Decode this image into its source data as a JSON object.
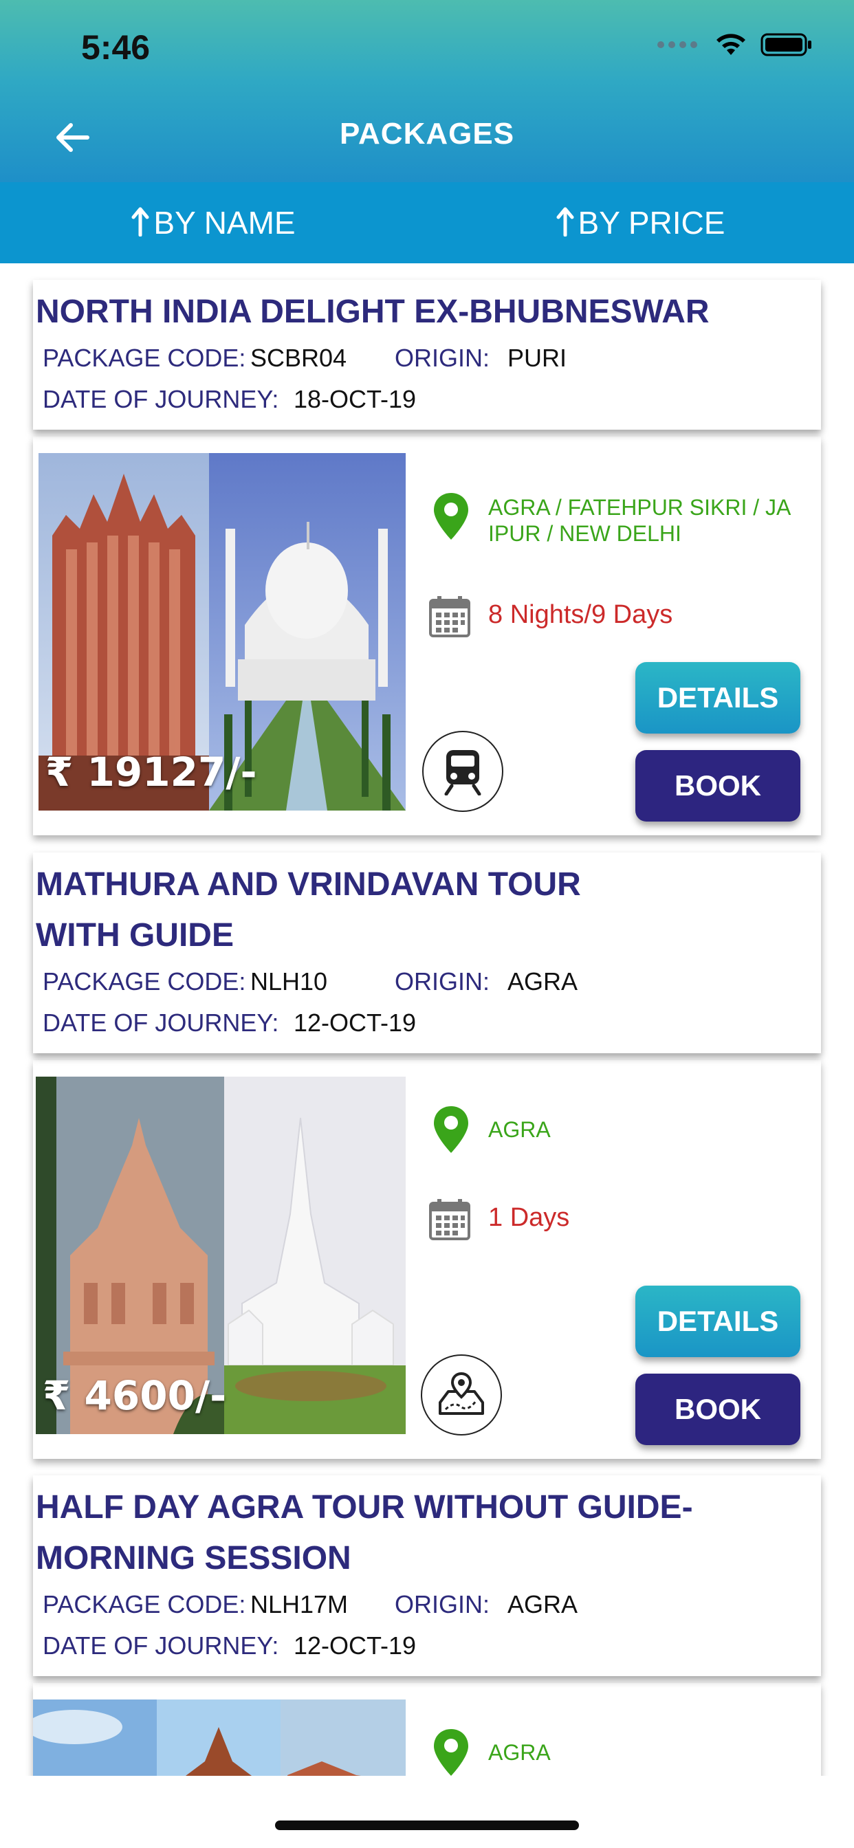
{
  "status": {
    "time": "5:46"
  },
  "header": {
    "title": "PACKAGES"
  },
  "sort": {
    "by_name": "BY NAME",
    "by_price": "BY PRICE"
  },
  "labels": {
    "package_code": "PACKAGE CODE:",
    "origin": "ORIGIN:",
    "date_of_journey": "DATE OF JOURNEY:"
  },
  "buttons": {
    "details": "DETAILS",
    "book": "BOOK"
  },
  "packages": [
    {
      "title_line1": "NORTH INDIA DELIGHT EX-BHUBNESWAR",
      "title_line2": "",
      "code": "SCBR04",
      "origin": "PURI",
      "date": "18-OCT-19",
      "price": "₹ 19127/-",
      "locations_line1": "AGRA / FATEHPUR SIKRI / JA",
      "locations_line2": "IPUR / NEW DELHI",
      "duration": "8 Nights/9 Days",
      "mode_icon": "train-icon"
    },
    {
      "title_line1": "MATHURA AND VRINDAVAN TOUR",
      "title_line2": "WITH GUIDE",
      "code": "NLH10",
      "origin": "AGRA",
      "date": "12-OCT-19",
      "price": "₹ 4600/-",
      "locations_line1": "AGRA",
      "locations_line2": "",
      "duration": "1 Days",
      "mode_icon": "map-route-icon"
    },
    {
      "title_line1": "HALF DAY AGRA TOUR WITHOUT GUIDE-",
      "title_line2": "MORNING SESSION",
      "code": "NLH17M",
      "origin": "AGRA",
      "date": "12-OCT-19",
      "locations_line1": "AGRA"
    }
  ]
}
